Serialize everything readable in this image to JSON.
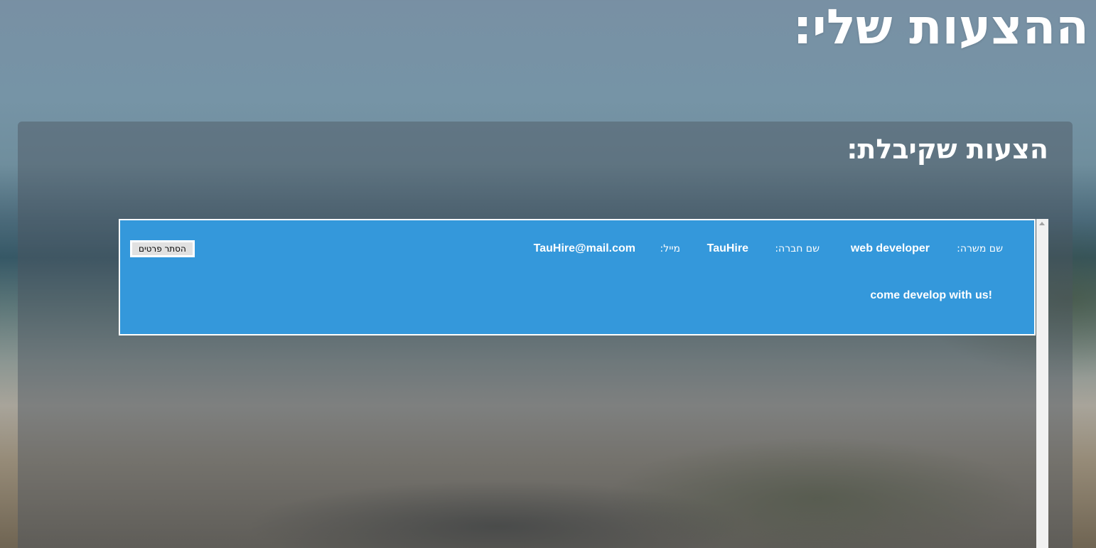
{
  "page": {
    "title": "ההצעות שלי:"
  },
  "panel": {
    "title": "הצעות שקיבלת:"
  },
  "offers": [
    {
      "job_title_label": "שם משרה:",
      "job_title": "web developer",
      "company_label": "שם חברה:",
      "company": "TauHire",
      "email_label": "מייל:",
      "email": "TauHire@mail.com",
      "description": "come develop with us!",
      "hide_button_label": "הסתר פרטים"
    }
  ],
  "colors": {
    "card_background": "#3498db",
    "card_border": "#ffffff",
    "text": "#ffffff"
  }
}
